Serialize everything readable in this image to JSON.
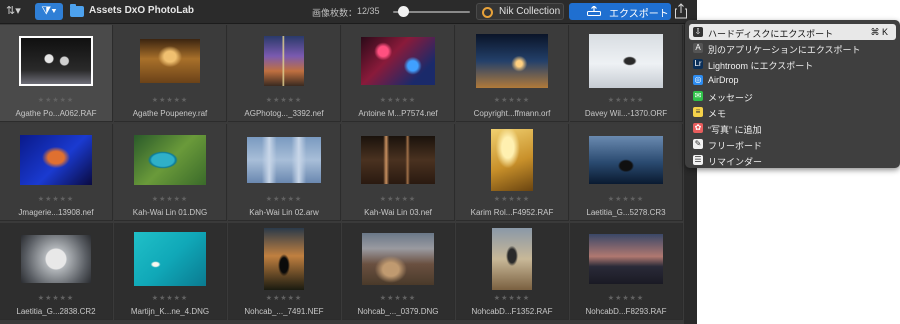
{
  "toolbar": {
    "folder_name": "Assets DxO PhotoLab",
    "count_label": "画像枚数：",
    "count_value": "12/35",
    "thumbnail_size": 0.08,
    "nik_label": "Nik Collection",
    "export_label": "エクスポート",
    "colors": {
      "accent": "#1f6fd0",
      "filter": "#2f7fd6",
      "folder": "#4da2ee"
    }
  },
  "images": [
    {
      "name": "Agathe Po...A062.RAF",
      "stars": "★★★★★",
      "selected": true,
      "thumb": "dancers-stage"
    },
    {
      "name": "Agathe Poupeney.raf",
      "stars": "★★★★★",
      "selected": false,
      "thumb": "opera-hall"
    },
    {
      "name": "AGPhotog..._3392.nef",
      "stars": "★★★★★",
      "selected": false,
      "thumb": "cathedral-window"
    },
    {
      "name": "Antoine M...P7574.nef",
      "stars": "★★★★★",
      "selected": false,
      "thumb": "neon-lights"
    },
    {
      "name": "Copyright...ffmann.orf",
      "stars": "★★★★★",
      "selected": false,
      "thumb": "night-city"
    },
    {
      "name": "Davey Wil...-1370.ORF",
      "stars": "★★★★★",
      "selected": false,
      "thumb": "snow-person"
    },
    {
      "name": "Jmagerie...13908.nef",
      "stars": "★★★★★",
      "selected": false,
      "thumb": "singer-blue"
    },
    {
      "name": "Kah-Wai Lin 01.DNG",
      "stars": "★★★★★",
      "selected": false,
      "thumb": "aerial-lake"
    },
    {
      "name": "Kah-Wai Lin 02.arw",
      "stars": "★★★★★",
      "selected": false,
      "thumb": "frosty-forest"
    },
    {
      "name": "Kah-Wai Lin 03.nef",
      "stars": "★★★★★",
      "selected": false,
      "thumb": "dark-forest"
    },
    {
      "name": "Karim Rol...F4952.RAF",
      "stars": "★★★★★",
      "selected": false,
      "thumb": "golden-field"
    },
    {
      "name": "Laetitia_G...5278.CR3",
      "stars": "★★★★★",
      "selected": false,
      "thumb": "sea-rock"
    },
    {
      "name": "Laetitia_G...2838.CR2",
      "stars": "★★★★★",
      "selected": false,
      "thumb": "buildings-up"
    },
    {
      "name": "Martijn_K...ne_4.DNG",
      "stars": "★★★★★",
      "selected": false,
      "thumb": "turquoise-sea"
    },
    {
      "name": "Nohcab_..._7491.NEF",
      "stars": "★★★★★",
      "selected": false,
      "thumb": "sunset-walk"
    },
    {
      "name": "Nohcab_..._0379.DNG",
      "stars": "★★★★★",
      "selected": false,
      "thumb": "volcanic-land"
    },
    {
      "name": "NohcabD...F1352.RAF",
      "stars": "★★★★★",
      "selected": false,
      "thumb": "desert-hiker"
    },
    {
      "name": "NohcabD...F8293.RAF",
      "stars": "★★★★★",
      "selected": false,
      "thumb": "dusk-mountains"
    }
  ],
  "menu": {
    "items": [
      {
        "label": "ハードディスクにエクスポート",
        "shortcut": "⌘ K",
        "icon": "disk-export-icon",
        "glyph": "⇩",
        "color": "#333333",
        "highlighted": true
      },
      {
        "label": "別のアプリケーションにエクスポート",
        "shortcut": "",
        "icon": "app-export-icon",
        "glyph": "A",
        "color": "#555555",
        "highlighted": false
      },
      {
        "label": "Lightroom にエクスポート",
        "shortcut": "",
        "icon": "lightroom-icon",
        "glyph": "Lr",
        "color": "#0b2f58",
        "highlighted": false
      },
      {
        "label": "AirDrop",
        "shortcut": "",
        "icon": "airdrop-icon",
        "glyph": "◎",
        "color": "#2d8cf0",
        "highlighted": false
      },
      {
        "label": "メッセージ",
        "shortcut": "",
        "icon": "messages-icon",
        "glyph": "✉",
        "color": "#30c34a",
        "highlighted": false
      },
      {
        "label": "メモ",
        "shortcut": "",
        "icon": "notes-icon",
        "glyph": "≡",
        "color": "#f5d24a",
        "highlighted": false
      },
      {
        "label": "“写真” に追加",
        "shortcut": "",
        "icon": "photos-icon",
        "glyph": "✿",
        "color": "#e85d5d",
        "highlighted": false
      },
      {
        "label": "フリーボード",
        "shortcut": "",
        "icon": "freeform-icon",
        "glyph": "✎",
        "color": "#f2f2f2",
        "highlighted": false
      },
      {
        "label": "リマインダー",
        "shortcut": "",
        "icon": "reminders-icon",
        "glyph": "☰",
        "color": "#f2f2f2",
        "highlighted": false
      }
    ]
  }
}
